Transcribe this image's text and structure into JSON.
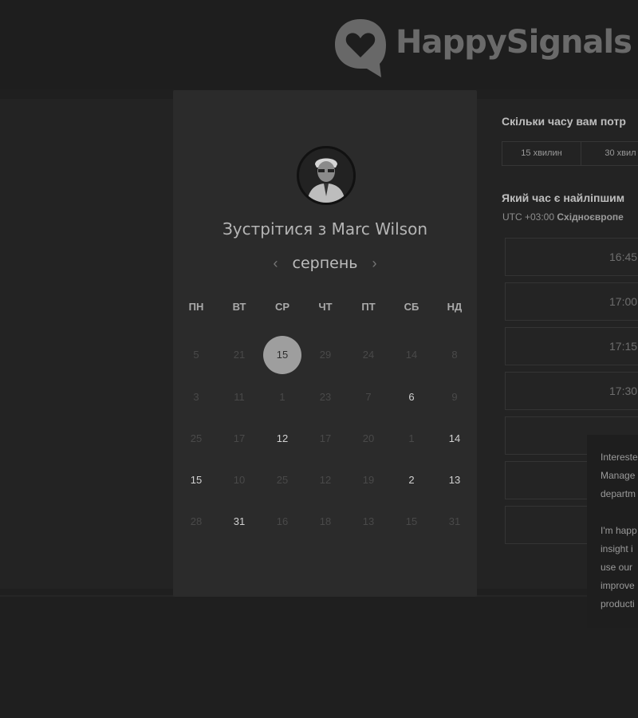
{
  "header": {
    "brand_name": "HappySignals",
    "logo_icon": "heart-speech-bubble-icon"
  },
  "card": {
    "avatar": "person-avatar",
    "meet_title": "Зустрітися з Marc Wilson",
    "month": "серпень",
    "prev_icon": "‹",
    "next_icon": "›",
    "weekdays": [
      "ПН",
      "ВТ",
      "СР",
      "ЧТ",
      "ПТ",
      "СБ",
      "НД"
    ],
    "weeks": [
      [
        {
          "d": "5",
          "on": false
        },
        {
          "d": "21",
          "on": false
        },
        {
          "d": "15",
          "on": true,
          "sel": true
        },
        {
          "d": "29",
          "on": false
        },
        {
          "d": "24",
          "on": false
        },
        {
          "d": "14",
          "on": false
        },
        {
          "d": "8",
          "on": false
        }
      ],
      [
        {
          "d": "3",
          "on": false
        },
        {
          "d": "11",
          "on": false
        },
        {
          "d": "1",
          "on": false
        },
        {
          "d": "23",
          "on": false
        },
        {
          "d": "7",
          "on": false
        },
        {
          "d": "6",
          "on": true
        },
        {
          "d": "9",
          "on": false
        }
      ],
      [
        {
          "d": "25",
          "on": false
        },
        {
          "d": "17",
          "on": false
        },
        {
          "d": "12",
          "on": true
        },
        {
          "d": "17",
          "on": false
        },
        {
          "d": "20",
          "on": false
        },
        {
          "d": "1",
          "on": false
        },
        {
          "d": "14",
          "on": true
        }
      ],
      [
        {
          "d": "15",
          "on": true
        },
        {
          "d": "10",
          "on": false
        },
        {
          "d": "25",
          "on": false
        },
        {
          "d": "12",
          "on": false
        },
        {
          "d": "19",
          "on": false
        },
        {
          "d": "2",
          "on": true
        },
        {
          "d": "13",
          "on": true
        }
      ],
      [
        {
          "d": "28",
          "on": false
        },
        {
          "d": "31",
          "on": true
        },
        {
          "d": "16",
          "on": false
        },
        {
          "d": "18",
          "on": false
        },
        {
          "d": "13",
          "on": false
        },
        {
          "d": "15",
          "on": false
        },
        {
          "d": "31",
          "on": false
        }
      ]
    ]
  },
  "right": {
    "duration_question": "Скільки часу вам потр",
    "durations": [
      "15 хвилин",
      "30 хвил"
    ],
    "time_question": "Який час є найліпшим",
    "timezone_prefix": "UTC +03:00",
    "timezone_name": "Східноєвропе",
    "slots": [
      "16:45",
      "17:00",
      "17:15",
      "17:30",
      "",
      "",
      ""
    ]
  },
  "popup": {
    "lines": [
      "Intereste",
      "Manage",
      "departm",
      "",
      "I'm happ",
      "insight i",
      "use our",
      "improve",
      "producti"
    ]
  },
  "colors": {
    "background": "#1f1f1f",
    "card": "#2b2b2b",
    "selected_day": "#9e9e9e",
    "brand": "#6a6a6a"
  }
}
